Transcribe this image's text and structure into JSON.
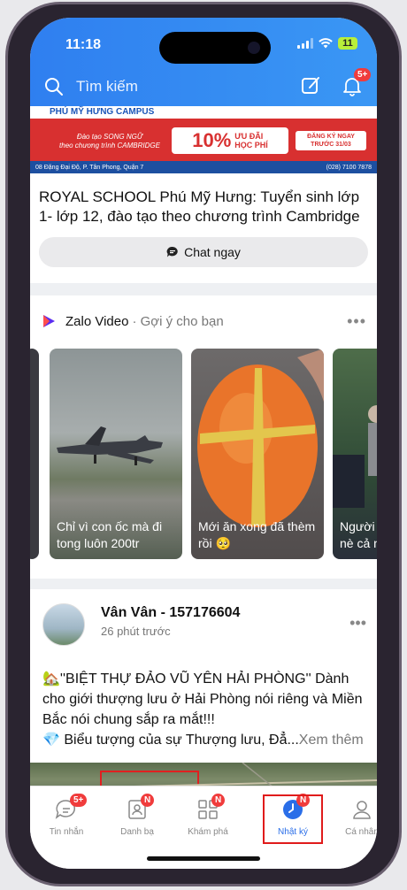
{
  "status": {
    "time": "11:18",
    "battery": "11"
  },
  "header": {
    "search_label": "Tìm kiếm",
    "notif_badge": "5+"
  },
  "ad": {
    "campus": "PHÚ MỸ HƯNG CAMPUS",
    "small_text_1": "Đào tạo SONG NGỮ",
    "small_text_2": "theo chương trình CAMBRIDGE",
    "percent": "10%",
    "offer_1": "ƯU ĐÃI",
    "offer_2": "HỌC PHÍ",
    "register_1": "ĐĂNG KÝ NGAY",
    "register_2": "TRƯỚC 31/03",
    "address": "08 Đặng Đại Độ, P. Tân Phong, Quận 7",
    "phone": "(028) 7100 7878",
    "title": "ROYAL SCHOOL Phú Mỹ Hưng: Tuyển sinh lớp 1- lớp 12, đào tạo theo chương trình Cambridge",
    "chat_label": "Chat ngay"
  },
  "zalo_video": {
    "title": "Zalo Video",
    "subtitle": "· Gợi ý cho bạn",
    "videos": [
      {
        "caption": "Chỉ vì con ốc mà đi tong luôn 200tr"
      },
      {
        "caption": "Mới ăn xong đã thèm rồi 🥺"
      },
      {
        "caption": "Người đẹp xe nè cả n"
      }
    ]
  },
  "post": {
    "author": "Vân Vân - 157176604",
    "time": "26 phút trước",
    "line1": "🏡''BIỆT THỰ ĐẢO VŨ YÊN HẢI PHÒNG'' Dành cho giới thượng lưu ở Hải Phòng nói riêng và Miền Bắc nói chung sắp ra mắt!!!",
    "line2": "💎 Biểu tượng của sự Thượng lưu, Đẳ...",
    "see_more": "Xem thêm"
  },
  "tabs": [
    {
      "label": "Tin nhắn",
      "badge": "5+"
    },
    {
      "label": "Danh bạ",
      "badge": "N"
    },
    {
      "label": "Khám phá",
      "badge": "N"
    },
    {
      "label": "Nhật ký",
      "badge": "N"
    },
    {
      "label": "Cá nhân",
      "badge": ""
    }
  ],
  "colors": {
    "accent": "#2f7ff0",
    "badge": "#f03c3c",
    "highlight": "#e01b1b"
  }
}
